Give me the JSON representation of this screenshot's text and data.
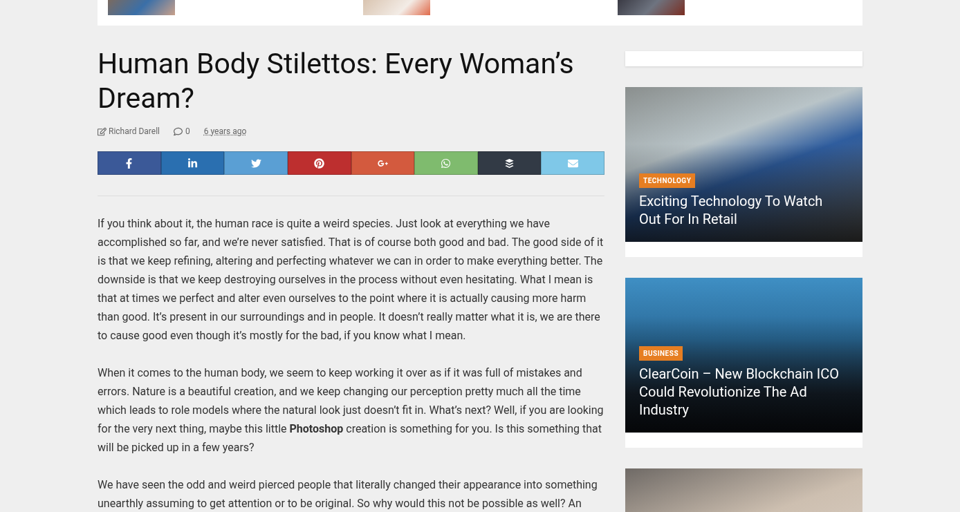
{
  "top_strip": {
    "thumbnails": [
      {
        "kind": "tablet"
      },
      {
        "kind": "phone"
      },
      {
        "kind": "drone"
      }
    ]
  },
  "article": {
    "title": "Human Body Stilettos: Every Woman’s Dream?",
    "meta": {
      "author": "Richard Darell",
      "comments": "0",
      "date": "6 years ago"
    },
    "share_buttons": [
      {
        "kind": "facebook",
        "color": "#3b5998"
      },
      {
        "kind": "linkedin",
        "color": "#2a6fb0"
      },
      {
        "kind": "twitter",
        "color": "#5a9fd4"
      },
      {
        "kind": "pinterest",
        "color": "#bd2f2f"
      },
      {
        "kind": "googleplus",
        "color": "#d35a3e"
      },
      {
        "kind": "whatsapp",
        "color": "#7fbb6e"
      },
      {
        "kind": "buffer",
        "color": "#323a45"
      },
      {
        "kind": "email",
        "color": "#7fc8e8"
      }
    ],
    "paragraphs": [
      "If you think about it, the human race is quite a weird species. Just look at everything we have accomplished so far, and we’re never satisfied. That is of course both good and bad. The good side of it is that we keep refining, altering and perfecting whatever we can in order to make everything better. The downside is that we keep destroying ourselves in the process without even hesitating. What I mean is that at times we perfect and alter even ourselves to the point where it is actually causing more harm than good. It’s present in our surroundings and in people. It doesn’t really matter what it is, we are there to cause good even though it’s mostly for the bad, if you know what I mean.",
      "When it comes to the human body, we seem to keep working it over as if it was full of mistakes and errors. Nature is a beautiful creation, and we keep changing our perception pretty much all the time which leads to role models where the natural look just doesn’t fit in. What’s next? Well, if you are looking for the very next thing, maybe this little **Photoshop** creation is something for you. Is this something that will be picked up in a few years?",
      "We have seen the odd and weird pierced people that literally changed their appearance into something unearthly assuming to get attention or to be original. So why would this not be possible as well? An"
    ]
  },
  "sidebar": {
    "posts": [
      {
        "kind": "retail",
        "category": "TECHNOLOGY",
        "title": "Exciting Technology To Watch Out For In Retail"
      },
      {
        "kind": "city",
        "category": "BUSINESS",
        "title": "ClearCoin – New Blockchain ICO Could Revolutionize The Ad Industry"
      },
      {
        "kind": "phone"
      }
    ]
  }
}
